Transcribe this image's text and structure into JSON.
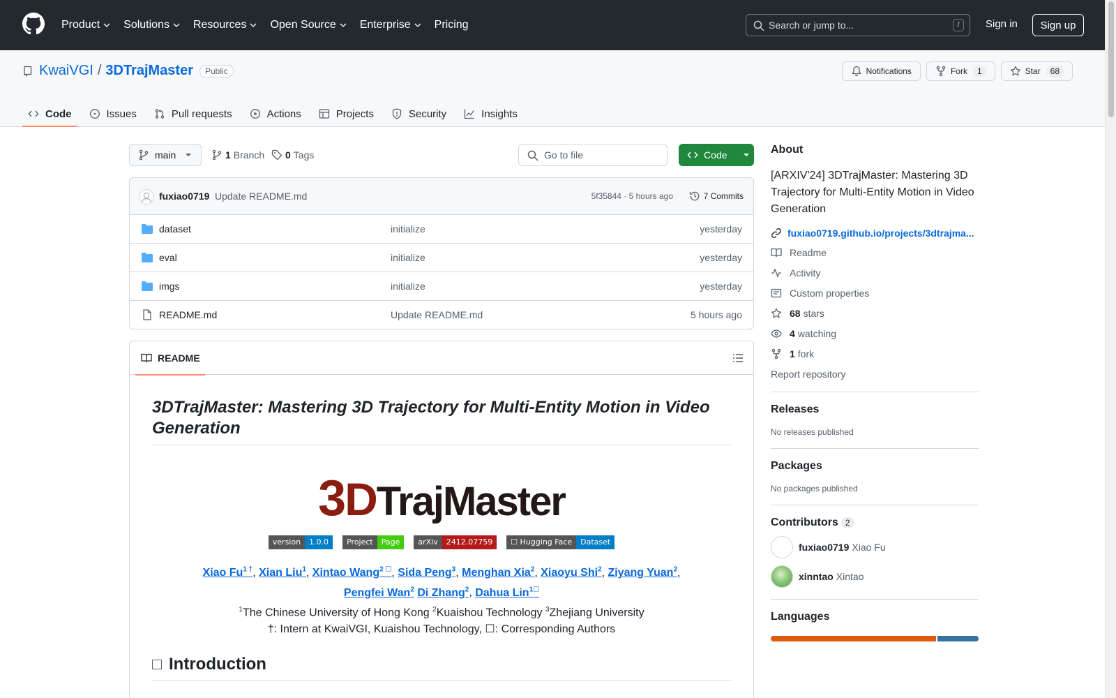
{
  "header": {
    "nav": [
      {
        "label": "Product",
        "dropdown": true
      },
      {
        "label": "Solutions",
        "dropdown": true
      },
      {
        "label": "Resources",
        "dropdown": true
      },
      {
        "label": "Open Source",
        "dropdown": true
      },
      {
        "label": "Enterprise",
        "dropdown": true
      },
      {
        "label": "Pricing",
        "dropdown": false
      }
    ],
    "search_placeholder": "Search or jump to...",
    "search_shortcut": "/",
    "sign_in": "Sign in",
    "sign_up": "Sign up"
  },
  "repo": {
    "owner": "KwaiVGI",
    "separator": "/",
    "name": "3DTrajMaster",
    "visibility": "Public",
    "notifications_label": "Notifications",
    "fork_label": "Fork",
    "fork_count": "1",
    "star_label": "Star",
    "star_count": "68"
  },
  "tabs": [
    {
      "label": "Code",
      "icon": "code-icon",
      "active": true
    },
    {
      "label": "Issues",
      "icon": "issue-icon",
      "active": false
    },
    {
      "label": "Pull requests",
      "icon": "pull-request-icon",
      "active": false
    },
    {
      "label": "Actions",
      "icon": "play-icon",
      "active": false
    },
    {
      "label": "Projects",
      "icon": "table-icon",
      "active": false
    },
    {
      "label": "Security",
      "icon": "shield-icon",
      "active": false
    },
    {
      "label": "Insights",
      "icon": "graph-icon",
      "active": false
    }
  ],
  "branchbar": {
    "branch": "main",
    "branch_count": "1",
    "branch_label": "Branch",
    "tag_count": "0",
    "tag_label": "Tags",
    "go_to_file": "Go to file",
    "code_button": "Code"
  },
  "commit": {
    "user": "fuxiao0719",
    "message": "Update README.md",
    "meta": "5f35844 · 5 hours ago",
    "count_label": "7 Commits"
  },
  "files": [
    {
      "type": "folder",
      "name": "dataset",
      "message": "initialize",
      "date": "yesterday"
    },
    {
      "type": "folder",
      "name": "eval",
      "message": "initialize",
      "date": "yesterday"
    },
    {
      "type": "folder",
      "name": "imgs",
      "message": "initialize",
      "date": "yesterday"
    },
    {
      "type": "file",
      "name": "README.md",
      "message": "Update README.md",
      "date": "5 hours ago"
    }
  ],
  "readme": {
    "tab_label": "README",
    "title": "3DTrajMaster: Mastering 3D Trajectory for Multi-Entity Motion in Video Generation",
    "logo_text": {
      "a": "3",
      "b": "D",
      "c": "TrajMaster"
    },
    "badges": [
      {
        "left": "version",
        "right": "1.0.0",
        "color": "#007ec6"
      },
      {
        "left": "Project",
        "right": "Page",
        "color": "#4c1"
      },
      {
        "left": "arXiv",
        "right": "2412.07759",
        "color": "#b31b1b"
      },
      {
        "left": "☐ Hugging Face",
        "right": "Dataset",
        "color": "#007ec6"
      }
    ],
    "authors_line1": [
      {
        "name": "Xiao Fu",
        "sup": "1 †"
      },
      {
        "name": "Xian Liu",
        "sup": "1"
      },
      {
        "name": "Xintao Wang",
        "sup": "2 ☐"
      },
      {
        "name": "Sida Peng",
        "sup": "3"
      },
      {
        "name": "Menghan Xia",
        "sup": "2"
      },
      {
        "name": "Xiaoyu Shi",
        "sup": "2"
      },
      {
        "name": "Ziyang Yuan",
        "sup": "2"
      }
    ],
    "authors_line2": [
      {
        "name": "Pengfei Wan",
        "sup": "2"
      },
      {
        "name": "Di Zhang",
        "sup": "2"
      },
      {
        "name": "Dahua Lin",
        "sup": "1☐"
      }
    ],
    "affiliations": {
      "a1_sup": "1",
      "a1": "The Chinese University of Hong Kong ",
      "a2_sup": "2",
      "a2": "Kuaishou Technology ",
      "a3_sup": "3",
      "a3": "Zhejiang University"
    },
    "note": "†: Intern at KwaiVGI, Kuaishou Technology, ☐: Corresponding Authors",
    "intro_heading": "Introduction"
  },
  "sidebar": {
    "about_heading": "About",
    "description": "[ARXIV'24] 3DTrajMaster: Mastering 3D Trajectory for Multi-Entity Motion in Video Generation",
    "website": "fuxiao0719.github.io/projects/3dtrajma...",
    "items": [
      {
        "icon": "book-icon",
        "count": "",
        "label": "Readme"
      },
      {
        "icon": "pulse-icon",
        "count": "",
        "label": "Activity"
      },
      {
        "icon": "note-icon",
        "count": "",
        "label": "Custom properties"
      },
      {
        "icon": "star-icon",
        "count": "68",
        "label": "stars"
      },
      {
        "icon": "eye-icon",
        "count": "4",
        "label": "watching"
      },
      {
        "icon": "fork-icon",
        "count": "1",
        "label": "fork"
      }
    ],
    "report": "Report repository",
    "releases_heading": "Releases",
    "releases_note": "No releases published",
    "packages_heading": "Packages",
    "packages_note": "No packages published",
    "contributors_heading": "Contributors",
    "contributors_count": "2",
    "contributors": [
      {
        "login": "fuxiao0719",
        "name": "Xiao Fu"
      },
      {
        "login": "xinntao",
        "name": "Xintao"
      }
    ],
    "languages_heading": "Languages",
    "languages_bar": [
      {
        "share": 0.8,
        "color": "#da5b0b"
      },
      {
        "share": 0.2,
        "color": "#3572a5"
      }
    ]
  }
}
